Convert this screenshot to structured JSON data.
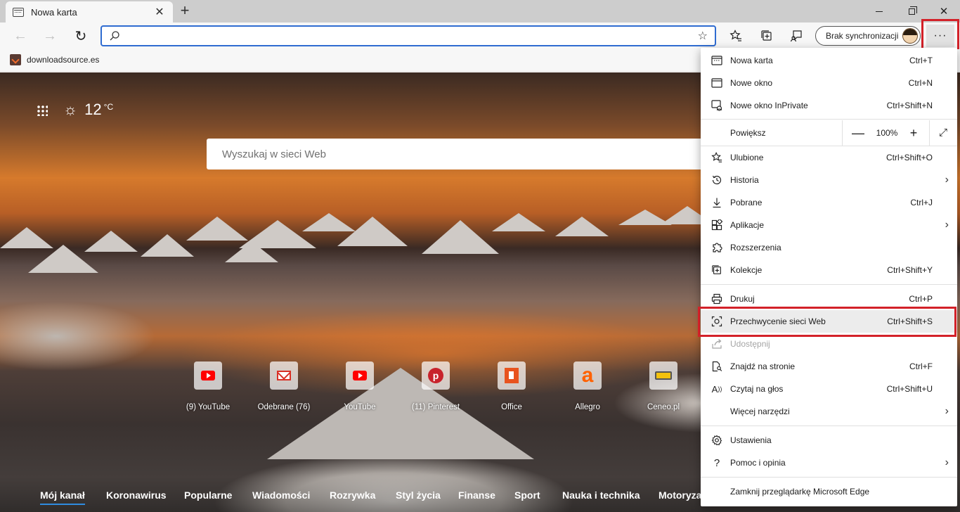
{
  "tab": {
    "title": "Nowa karta",
    "close": "✕"
  },
  "toolbar": {
    "new_tab": "+",
    "back": "←",
    "forward": "→",
    "reload": "↻",
    "address_value": "",
    "address_placeholder": "",
    "sync_label": "Brak synchronizacji",
    "more": "···"
  },
  "favorites": [
    {
      "label": "downloadsource.es"
    }
  ],
  "window_controls": {
    "close": "✕"
  },
  "ntp": {
    "temperature": "12",
    "temperature_unit": "°C",
    "search_placeholder": "Wyszukaj w sieci Web",
    "tiles": [
      {
        "label": "(9) YouTube",
        "icon": "youtube-icon"
      },
      {
        "label": "Odebrane (76)",
        "icon": "gmail-icon"
      },
      {
        "label": "YouTube",
        "icon": "youtube-icon"
      },
      {
        "label": "(11) Pinterest",
        "icon": "pinterest-icon"
      },
      {
        "label": "Office",
        "icon": "office-icon"
      },
      {
        "label": "Allegro",
        "icon": "allegro-icon"
      },
      {
        "label": "Ceneo.pl",
        "icon": "ceneo-icon"
      }
    ],
    "news_nav": [
      "Mój kanał",
      "Koronawirus",
      "Popularne",
      "Wiadomości",
      "Rozrywka",
      "Styl życia",
      "Finanse",
      "Sport",
      "Nauka i technika",
      "Motoryza"
    ]
  },
  "menu": {
    "new_tab": {
      "label": "Nowa karta",
      "shortcut": "Ctrl+T"
    },
    "new_window": {
      "label": "Nowe okno",
      "shortcut": "Ctrl+N"
    },
    "new_inprivate": {
      "label": "Nowe okno InPrivate",
      "shortcut": "Ctrl+Shift+N"
    },
    "zoom": {
      "label": "Powiększ",
      "value": "100%",
      "minus": "—",
      "plus": "+",
      "fullscreen": "⤢"
    },
    "favorites": {
      "label": "Ulubione",
      "shortcut": "Ctrl+Shift+O"
    },
    "history": {
      "label": "Historia"
    },
    "downloads": {
      "label": "Pobrane",
      "shortcut": "Ctrl+J"
    },
    "apps": {
      "label": "Aplikacje"
    },
    "extensions": {
      "label": "Rozszerzenia"
    },
    "collections": {
      "label": "Kolekcje",
      "shortcut": "Ctrl+Shift+Y"
    },
    "print": {
      "label": "Drukuj",
      "shortcut": "Ctrl+P"
    },
    "web_capture": {
      "label": "Przechwycenie sieci Web",
      "shortcut": "Ctrl+Shift+S"
    },
    "share": {
      "label": "Udostępnij"
    },
    "find": {
      "label": "Znajdź na stronie",
      "shortcut": "Ctrl+F"
    },
    "read_aloud": {
      "label": "Czytaj na głos",
      "shortcut": "Ctrl+Shift+U"
    },
    "more_tools": {
      "label": "Więcej narzędzi"
    },
    "settings": {
      "label": "Ustawienia"
    },
    "help": {
      "label": "Pomoc i opinia"
    },
    "close_edge": {
      "label": "Zamknij przeglądarkę Microsoft Edge"
    }
  },
  "colors": {
    "accent": "#2f6cd1",
    "highlight": "#d32129",
    "tab_strip": "#cdcdcd",
    "toolbar": "#f7f7f7"
  }
}
